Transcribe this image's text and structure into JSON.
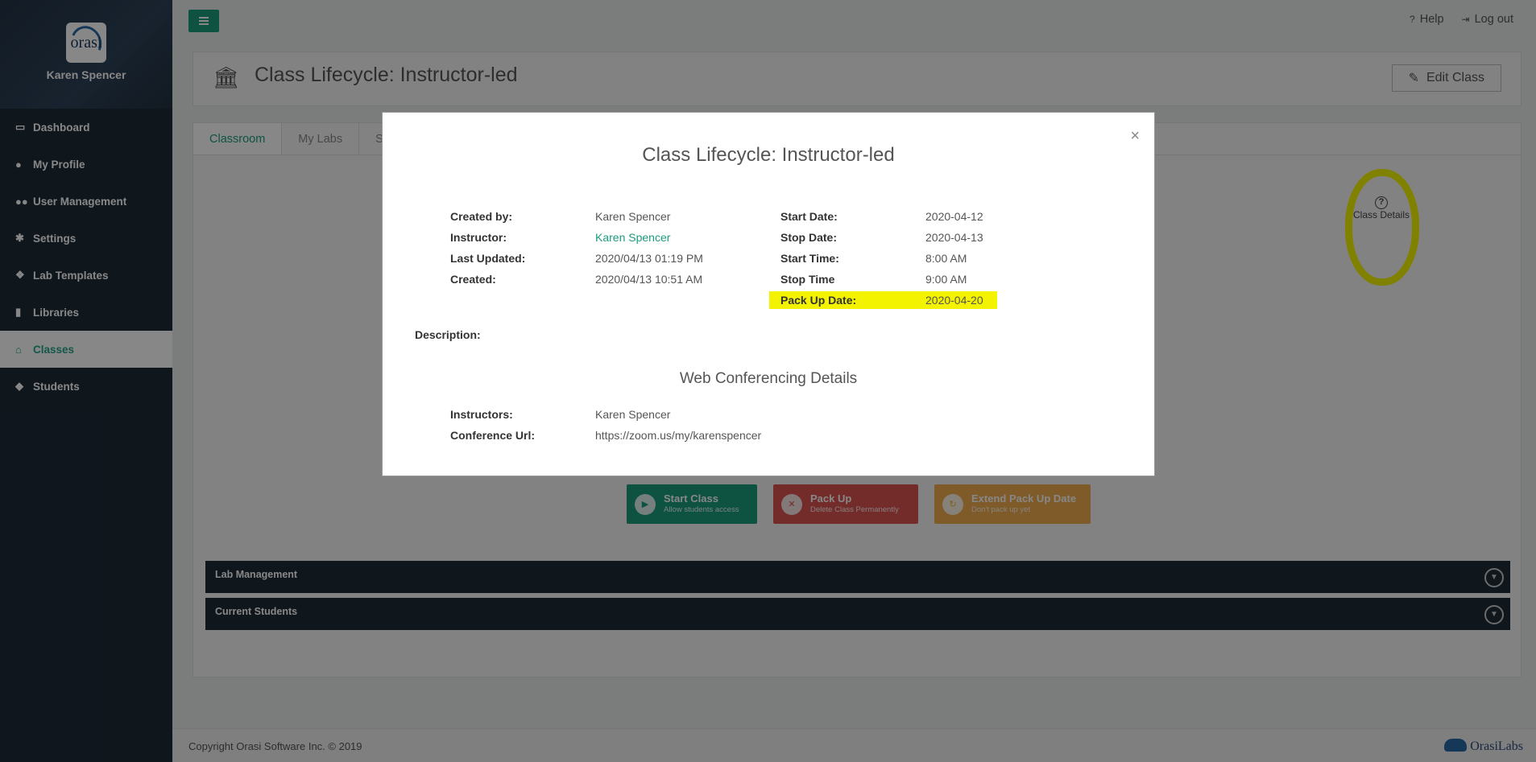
{
  "sidebar": {
    "logo_text": "orasi",
    "user_name": "Karen Spencer",
    "items": [
      {
        "label": "Dashboard",
        "icon": "monitor-icon"
      },
      {
        "label": "My Profile",
        "icon": "user-icon"
      },
      {
        "label": "User Management",
        "icon": "users-icon"
      },
      {
        "label": "Settings",
        "icon": "gear-icon"
      },
      {
        "label": "Lab Templates",
        "icon": "cubes-icon"
      },
      {
        "label": "Libraries",
        "icon": "book-icon"
      },
      {
        "label": "Classes",
        "icon": "bank-icon",
        "active": true
      },
      {
        "label": "Students",
        "icon": "graduation-cap-icon"
      }
    ]
  },
  "topbar": {
    "help": "Help",
    "logout": "Log out"
  },
  "page": {
    "title": "Class Lifecycle: Instructor-led",
    "edit_button": "Edit Class"
  },
  "tabs": [
    "Classroom",
    "My Labs",
    "S"
  ],
  "class_details_label": "Class Details",
  "actions": {
    "start": {
      "title": "Start Class",
      "sub": "Allow students access"
    },
    "packup": {
      "title": "Pack Up",
      "sub": "Delete Class Permanently"
    },
    "extend": {
      "title": "Extend Pack Up Date",
      "sub": "Don't pack up yet"
    }
  },
  "accordions": [
    "Lab Management",
    "Current Students"
  ],
  "footer": {
    "copyright": "Copyright Orasi Software Inc. © 2019",
    "brand": "OrasiLabs"
  },
  "modal": {
    "title": "Class Lifecycle: Instructor-led",
    "left": [
      {
        "label": "Created by:",
        "value": "Karen Spencer"
      },
      {
        "label": "Instructor:",
        "value": "Karen Spencer"
      },
      {
        "label": "Last Updated:",
        "value": "2020/04/13 01:19 PM"
      },
      {
        "label": "Created:",
        "value": "2020/04/13 10:51 AM"
      }
    ],
    "right": [
      {
        "label": "Start Date:",
        "value": "2020-04-12"
      },
      {
        "label": "Stop Date:",
        "value": "2020-04-13"
      },
      {
        "label": "Start Time:",
        "value": "8:00 AM"
      },
      {
        "label": "Stop Time",
        "value": "9:00 AM"
      },
      {
        "label": "Pack Up Date:",
        "value": "2020-04-20"
      }
    ],
    "description_label": "Description:",
    "web_title": "Web Conferencing Details",
    "web": [
      {
        "label": "Instructors:",
        "value": "Karen Spencer"
      },
      {
        "label": "Conference Url:",
        "value": "https://zoom.us/my/karenspencer"
      }
    ],
    "highlight_color": "#f3f300"
  },
  "colors": {
    "accent": "#1b9c7e",
    "sidebar": "#1e2a36",
    "danger": "#d9534f",
    "warning": "#f0ad4e"
  }
}
